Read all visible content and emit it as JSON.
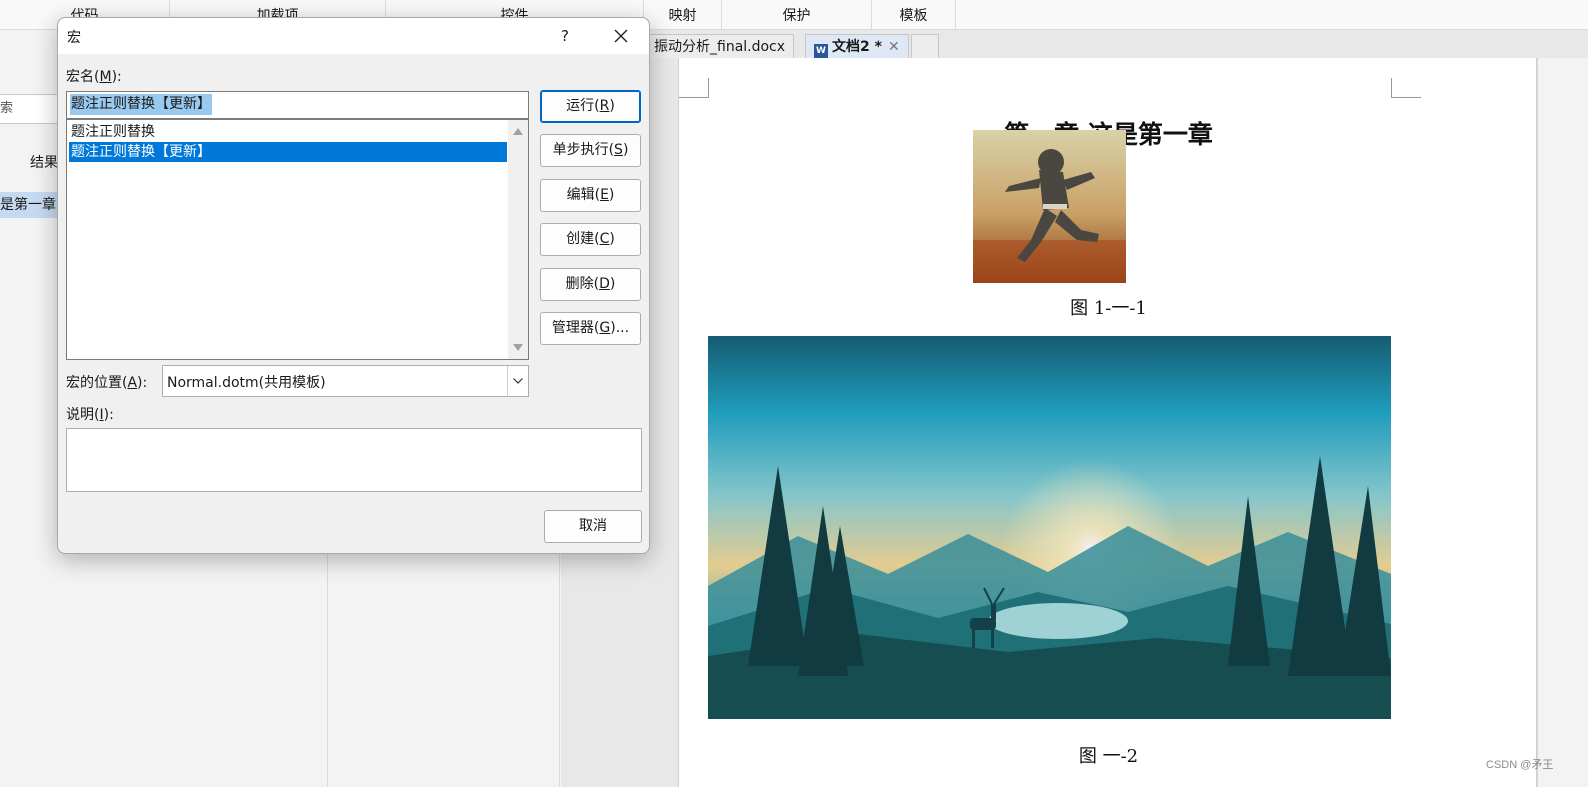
{
  "ribbon": {
    "groups": [
      "代码",
      "加载项",
      "控件",
      "映射",
      "保护",
      "模板"
    ]
  },
  "nav_pane": {
    "search_fragment": "索",
    "results_label": "结果",
    "heading_item": "是第一章"
  },
  "doc_tabs": [
    {
      "label": "振动分析_final.docx",
      "active": false
    },
    {
      "label": "文档2 *",
      "active": true
    }
  ],
  "document": {
    "heading": "第一章 这是第一章",
    "caption_1": "图  1-一-1",
    "caption_2": "图  一-2"
  },
  "dialog": {
    "title": "宏",
    "help_icon": "?",
    "macro_name_label": "宏名",
    "macro_name_key": "M",
    "macro_name_value": "题注正则替换【更新】",
    "macro_list": [
      "题注正则替换",
      "题注正则替换【更新】"
    ],
    "selected_index": 1,
    "buttons": {
      "run": {
        "label": "运行",
        "key": "R"
      },
      "step": {
        "label": "单步执行",
        "key": "S"
      },
      "edit": {
        "label": "编辑",
        "key": "E"
      },
      "create": {
        "label": "创建",
        "key": "C"
      },
      "delete": {
        "label": "删除",
        "key": "D"
      },
      "organizer": {
        "label": "管理器",
        "key": "G",
        "suffix": "..."
      }
    },
    "location_label": "宏的位置",
    "location_key": "A",
    "location_value": "Normal.dotm(共用模板)",
    "description_label": "说明",
    "description_key": "I",
    "description_value": "",
    "cancel_label": "取消"
  },
  "watermark": "CSDN @矛王",
  "colors": {
    "selection_blue": "#0078d7",
    "input_selection": "#99c9ef",
    "word_blue": "#2b579a"
  }
}
